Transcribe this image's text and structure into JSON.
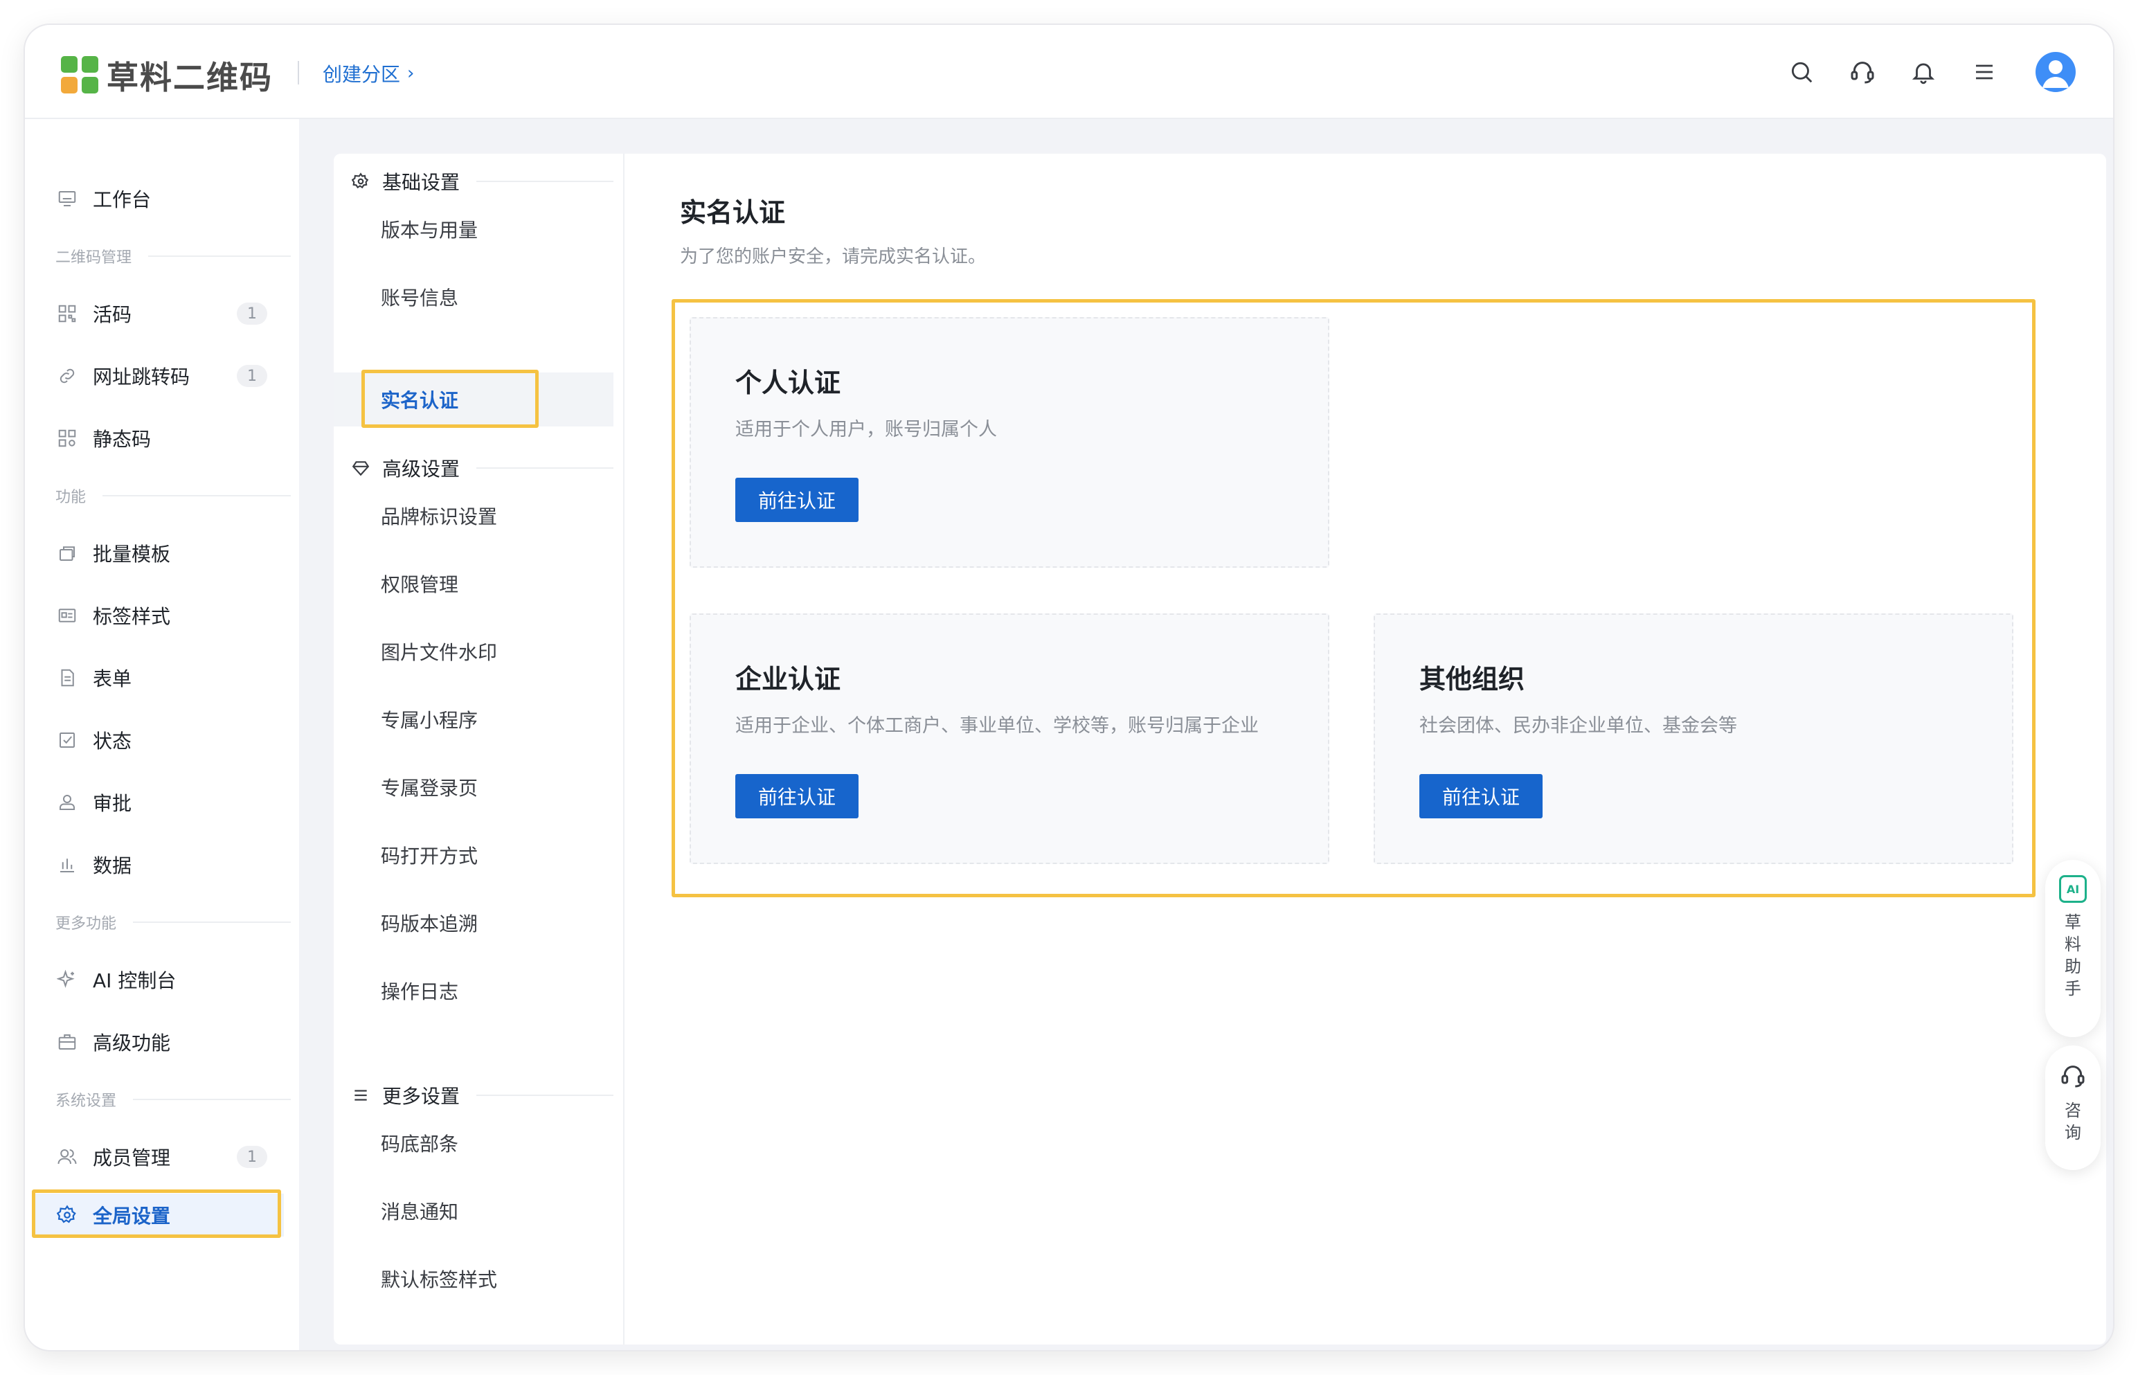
{
  "header": {
    "logo_text": "草料二维码",
    "breadcrumb": "创建分区",
    "breadcrumb_chevron": "›",
    "icons": [
      "search-icon",
      "headset-icon",
      "bell-icon",
      "menu-icon",
      "avatar"
    ]
  },
  "sidebar": {
    "items": {
      "workbench": "工作台",
      "live_code": "活码",
      "url_redirect": "网址跳转码",
      "static_code": "静态码",
      "batch_template": "批量模板",
      "label_style": "标签样式",
      "form": "表单",
      "status": "状态",
      "approval": "审批",
      "data": "数据",
      "ai_console": "AI 控制台",
      "advanced": "高级功能",
      "members": "成员管理",
      "global_settings": "全局设置"
    },
    "groups": {
      "qr_manage": "二维码管理",
      "features": "功能",
      "more_features": "更多功能",
      "system_settings": "系统设置"
    },
    "badges": {
      "live_code": "1",
      "url_redirect": "1",
      "members": "1"
    }
  },
  "settings_nav": {
    "groups": {
      "basic": "基础设置",
      "advanced": "高级设置",
      "more": "更多设置"
    },
    "items": {
      "version_usage": "版本与用量",
      "account_info": "账号信息",
      "real_name": "实名认证",
      "brand_logo": "品牌标识设置",
      "permissions": "权限管理",
      "image_watermark": "图片文件水印",
      "mini_program": "专属小程序",
      "login_page": "专属登录页",
      "open_method": "码打开方式",
      "version_trace": "码版本追溯",
      "operation_log": "操作日志",
      "footer_terms": "码底部条",
      "notifications": "消息通知",
      "default_label": "默认标签样式"
    }
  },
  "main": {
    "title": "实名认证",
    "subtitle": "为了您的账户安全，请完成实名认证。",
    "cards": {
      "personal": {
        "title": "个人认证",
        "desc": "适用于个人用户，账号归属个人",
        "button": "前往认证"
      },
      "enterprise": {
        "title": "企业认证",
        "desc": "适用于企业、个体工商户、事业单位、学校等，账号归属于企业",
        "button": "前往认证"
      },
      "other": {
        "title": "其他组织",
        "desc": "社会团体、民办非企业单位、基金会等",
        "button": "前往认证"
      }
    }
  },
  "float": {
    "assistant": {
      "badge": "AI",
      "label": "草料助手"
    },
    "consult": {
      "label": "咨询"
    }
  },
  "colors": {
    "accent": "#1765cc",
    "highlight": "#f5c242",
    "logo_green": "#56b447",
    "logo_orange": "#f2a93b"
  }
}
